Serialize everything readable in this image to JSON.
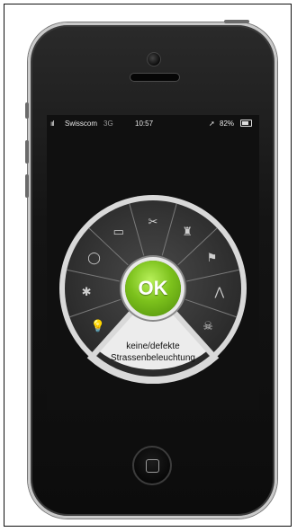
{
  "status_bar": {
    "signal": "ııl",
    "carrier": "Swisscom",
    "network": "3G",
    "time": "10:57",
    "location_icon": "location-arrow-icon",
    "battery_percent": "82%"
  },
  "wheel": {
    "center_button_label": "OK",
    "selected_label_line1": "keine/defekte",
    "selected_label_line2": "Strassenbeleuchtung",
    "sectors": [
      {
        "icon": "street-lamp-icon",
        "glyph": "💡"
      },
      {
        "icon": "bug-icon",
        "glyph": "✱"
      },
      {
        "icon": "ring-icon",
        "glyph": "◯"
      },
      {
        "icon": "bin-icon",
        "glyph": "▭"
      },
      {
        "icon": "tools-icon",
        "glyph": "✂"
      },
      {
        "icon": "trash-can-icon",
        "glyph": "♜"
      },
      {
        "icon": "sign-icon",
        "glyph": "⚑"
      },
      {
        "icon": "road-icon",
        "glyph": "⋀"
      },
      {
        "icon": "skull-icon",
        "glyph": "☠"
      }
    ],
    "colors": {
      "ok_green": "#7cc11c",
      "wheel_dark": "#3b3b3b",
      "panel_light": "#e6e6e6"
    }
  }
}
